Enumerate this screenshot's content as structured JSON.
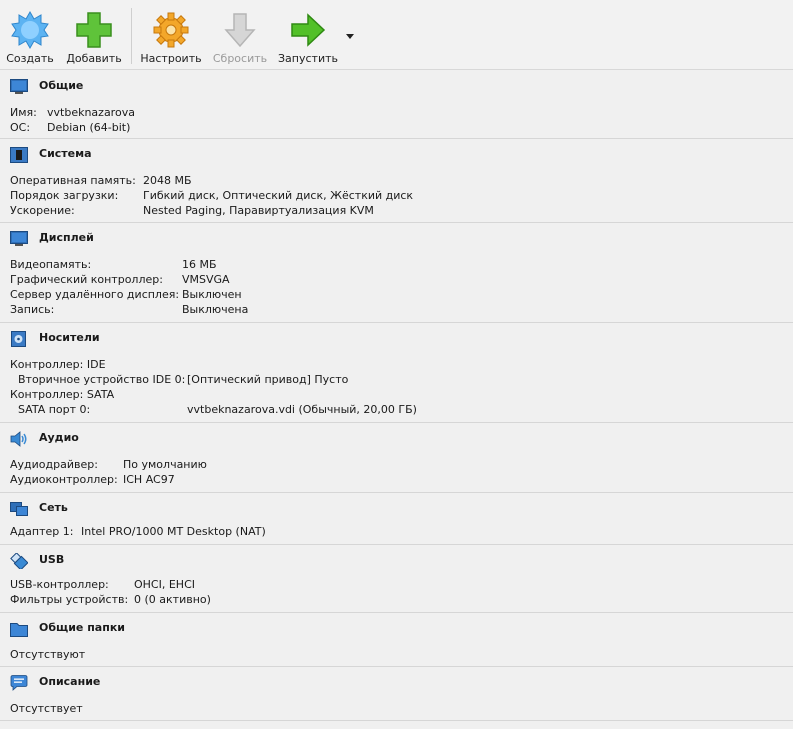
{
  "toolbar": {
    "create": "Создать",
    "add": "Добавить",
    "settings": "Настроить",
    "discard": "Сбросить",
    "start": "Запустить"
  },
  "general": {
    "title": "Общие",
    "name_label": "Имя:",
    "name_value": "vvtbeknazarova",
    "os_label": "ОС:",
    "os_value": "Debian (64-bit)"
  },
  "system": {
    "title": "Система",
    "ram_label": "Оперативная память:",
    "ram_value": "2048 МБ",
    "boot_label": "Порядок загрузки:",
    "boot_value": "Гибкий диск, Оптический диск, Жёсткий диск",
    "accel_label": "Ускорение:",
    "accel_value": "Nested Paging, Паравиртуализация KVM"
  },
  "display": {
    "title": "Дисплей",
    "vram_label": "Видеопамять:",
    "vram_value": "16 МБ",
    "gc_label": "Графический контроллер:",
    "gc_value": "VMSVGA",
    "rds_label": "Сервер удалённого дисплея:",
    "rds_value": "Выключен",
    "rec_label": "Запись:",
    "rec_value": "Выключена"
  },
  "storage": {
    "title": "Носители",
    "ctrl_ide": "Контроллер: IDE",
    "ide_dev_label": "Вторичное устройство IDE 0:",
    "ide_dev_value": "[Оптический привод] Пусто",
    "ctrl_sata": "Контроллер: SATA",
    "sata_label": "SATA порт 0:",
    "sata_value": "vvtbeknazarova.vdi (Обычный, 20,00 ГБ)"
  },
  "audio": {
    "title": "Аудио",
    "driver_label": "Аудиодрайвер:",
    "driver_value": "По умолчанию",
    "ctrl_label": "Аудиоконтроллер:",
    "ctrl_value": "ICH AC97"
  },
  "network": {
    "title": "Сеть",
    "adapter_label": "Адаптер 1:",
    "adapter_value": "Intel PRO/1000 MT Desktop (NAT)"
  },
  "usb": {
    "title": "USB",
    "ctrl_label": "USB-контроллер:",
    "ctrl_value": "OHCI, EHCI",
    "filters_label": "Фильтры устройств:",
    "filters_value": "0 (0 активно)"
  },
  "shared": {
    "title": "Общие папки",
    "value": "Отсутствуют"
  },
  "description": {
    "title": "Описание",
    "value": "Отсутствует"
  }
}
